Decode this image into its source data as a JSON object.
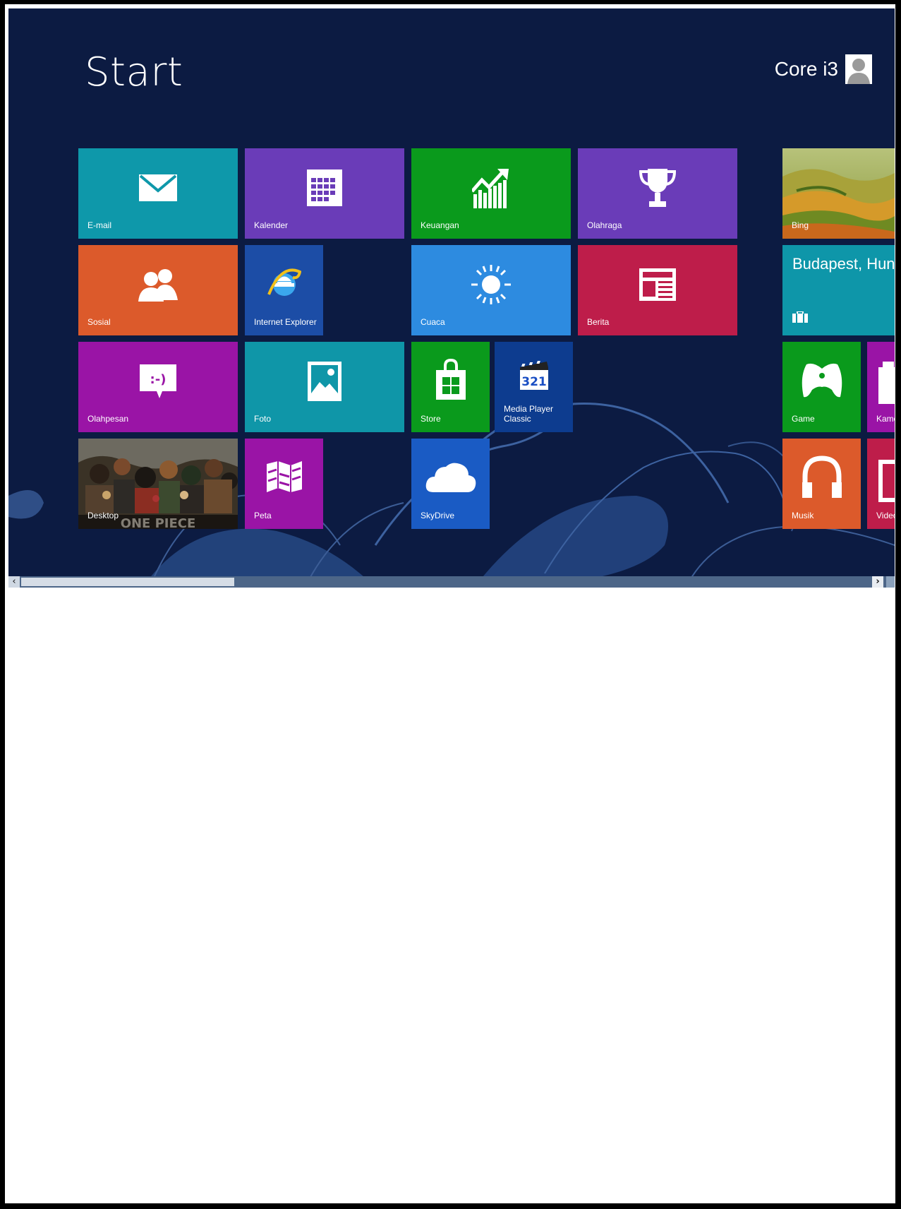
{
  "start": {
    "title": "Start"
  },
  "user": {
    "name": "Core i3"
  },
  "tiles": {
    "email": "E-mail",
    "kalender": "Kalender",
    "keuangan": "Keuangan",
    "olahraga": "Olahraga",
    "bing": "Bing",
    "sosial": "Sosial",
    "ie": "Internet Explorer",
    "cuaca": "Cuaca",
    "berita": "Berita",
    "travel_city": "Budapest, Hunga",
    "olahpesan": "Olahpesan",
    "foto": "Foto",
    "store": "Store",
    "mpc": "Media Player\nClassic",
    "mpc_badge": "321",
    "game": "Game",
    "kamera": "Kame",
    "desktop": "Desktop",
    "peta": "Peta",
    "skydrive": "SkyDrive",
    "musik": "Musik",
    "video": "Video"
  },
  "scrollbar": {
    "left_arrow": "‹",
    "right_arrow": "›",
    "thumb_fraction": 0.25
  },
  "colors": {
    "background": "#0d1d44",
    "teal": "#0f97a9",
    "purple": "#6d3ab8",
    "green": "#0b9a1e",
    "orange": "#dd5a2c",
    "ie_blue": "#1d4ea8",
    "sky_blue": "#2b89e0",
    "crimson": "#bf1e4b",
    "magenta": "#9a14a6",
    "navy": "#0d3c8f"
  }
}
